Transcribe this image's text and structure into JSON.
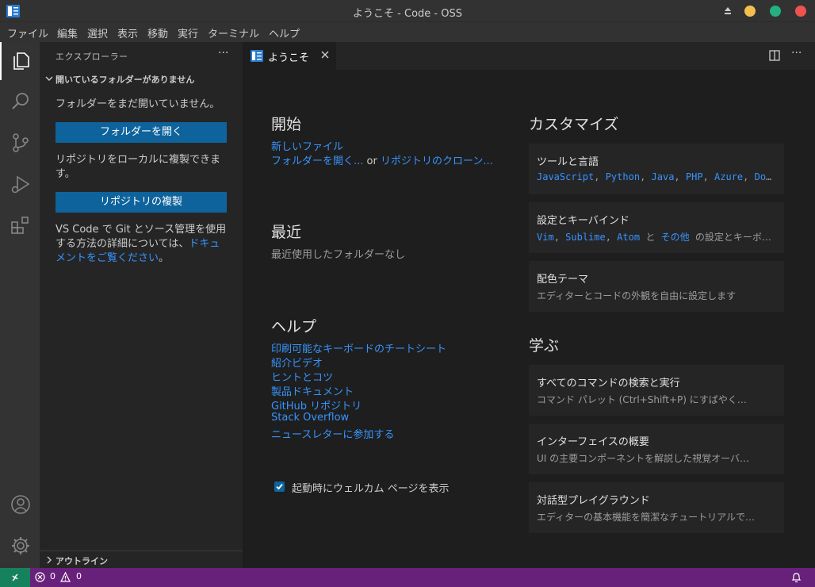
{
  "window": {
    "title": "ようこそ - Code - OSS",
    "buttons": {
      "minimize_color": "#f5bf4f",
      "maximize_color": "#25b07f",
      "close_color": "#ef5350"
    }
  },
  "menu": [
    "ファイル",
    "編集",
    "選択",
    "表示",
    "移動",
    "実行",
    "ターミナル",
    "ヘルプ"
  ],
  "activity_bar": {
    "icons": [
      "explorer-icon",
      "search-icon",
      "source-control-icon",
      "run-debug-icon",
      "extensions-icon",
      "account-icon",
      "settings-gear-icon"
    ]
  },
  "sidebar": {
    "title": "エクスプローラー",
    "more": "···",
    "section_title": "開いているフォルダーがありません",
    "no_folder_text": "フォルダーをまだ開いていません。",
    "open_folder_button": "フォルダーを開く",
    "clone_text": "リポジトリをローカルに複製できます。",
    "clone_button": "リポジトリの複製",
    "git_text_1": "VS Code で Git とソース管理を使用",
    "git_text_2": "する方法の詳細については、",
    "git_link_1": "ドキュ",
    "git_link_2": "メントをご覧ください",
    "git_text_end": "。",
    "outline_title": "アウトライン"
  },
  "tabs": [
    {
      "label": "ようこそ",
      "close": "×"
    }
  ],
  "editor_more": "···",
  "welcome": {
    "start": {
      "heading": "開始",
      "new_file": "新しいファイル",
      "open_folder": "フォルダーを開く...",
      "or": "or",
      "clone_repo": "リポジトリのクローン..."
    },
    "recent": {
      "heading": "最近",
      "empty": "最近使用したフォルダーなし"
    },
    "help": {
      "heading": "ヘルプ",
      "links": [
        "印刷可能なキーボードのチートシート",
        "紹介ビデオ",
        "ヒントとコツ",
        "製品ドキュメント",
        "GitHub リポジトリ",
        "Stack Overflow",
        "ニュースレターに参加する"
      ]
    },
    "show_on_startup": {
      "label": "起動時にウェルカム ページを表示",
      "checked": true
    },
    "customize": {
      "heading": "カスタマイズ",
      "cards": [
        {
          "title": "ツールと言語",
          "links": [
            "JavaScript",
            "Python",
            "Java",
            "PHP",
            "Azure",
            "Docker"
          ],
          "sep": ", ",
          "more": "…"
        },
        {
          "title": "設定とキーバインド",
          "links": [
            "Vim",
            "Sublime",
            "Atom"
          ],
          "and": "と",
          "other": "その他",
          "suffix": "の設定とキーボ…"
        },
        {
          "title": "配色テーマ",
          "desc": "エディターとコードの外観を自由に設定します"
        }
      ]
    },
    "learn": {
      "heading": "学ぶ",
      "cards": [
        {
          "title": "すべてのコマンドの検索と実行",
          "desc": "コマンド パレット (Ctrl+Shift+P) にすばやく…"
        },
        {
          "title": "インターフェイスの概要",
          "desc": "UI の主要コンポーネントを解説した視覚オーバ…"
        },
        {
          "title": "対話型プレイグラウンド",
          "desc": "エディターの基本機能を簡潔なチュートリアルで…"
        }
      ]
    }
  },
  "statusbar": {
    "errors": "0",
    "warnings": "0",
    "remote_color": "#16825d",
    "bar_color": "#68217a"
  }
}
